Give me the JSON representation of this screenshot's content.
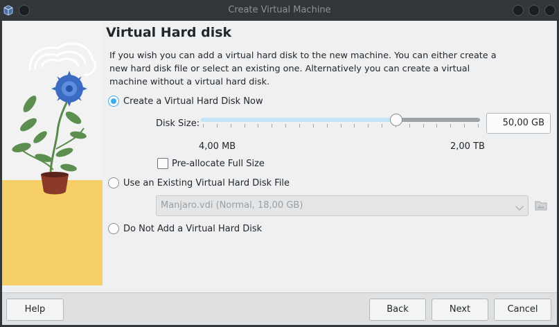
{
  "window": {
    "title": "Create Virtual Machine"
  },
  "page": {
    "heading": "Virtual Hard disk",
    "description": "If you wish you can add a virtual hard disk to the new machine. You can either create a new hard disk file or select an existing one. Alternatively you can create a virtual machine without a virtual hard disk."
  },
  "options": {
    "create_now": {
      "label": "Create a Virtual Hard Disk Now",
      "selected": true
    },
    "use_existing": {
      "label": "Use an Existing Virtual Hard Disk File",
      "selected": false
    },
    "no_disk": {
      "label": "Do Not Add a Virtual Hard Disk",
      "selected": false
    }
  },
  "disk_size": {
    "label": "Disk Size:",
    "value": "50,00 GB",
    "min_label": "4,00 MB",
    "max_label": "2,00 TB",
    "slider_fraction": 0.7
  },
  "preallocate": {
    "label": "Pre-allocate Full Size",
    "checked": false
  },
  "existing_file": {
    "value": "Manjaro.vdi (Normal, 18,00 GB)"
  },
  "buttons": {
    "help": "Help",
    "back": "Back",
    "next": "Next",
    "cancel": "Cancel"
  },
  "colors": {
    "accent": "#3daee9",
    "slider_fill": "#c5e4f6",
    "titlebar": "#31363b",
    "content_bg": "#eff0f1"
  },
  "icons": {
    "app": "virtualbox-icon",
    "folder": "folder-open-icon",
    "watermark": "plant-illustration"
  }
}
